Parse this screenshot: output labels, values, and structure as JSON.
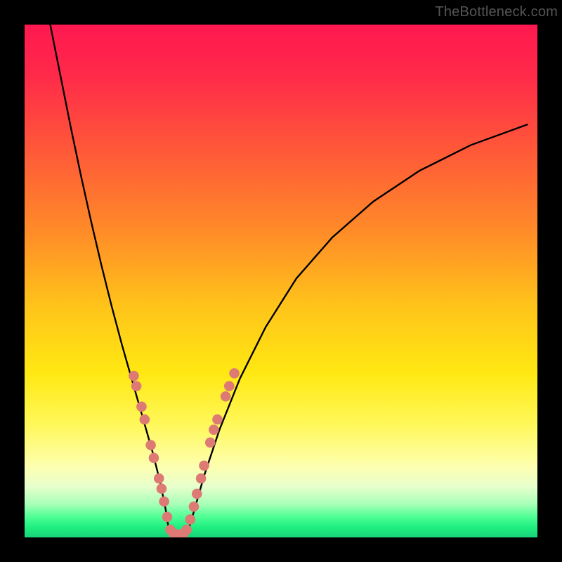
{
  "watermark": "TheBottleneck.com",
  "chart_data": {
    "type": "line",
    "title": "",
    "xlabel": "",
    "ylabel": "",
    "xlim": [
      0,
      100
    ],
    "ylim": [
      0,
      100
    ],
    "background_gradient_stops": [
      {
        "pos": 0.0,
        "color": "#ff1850"
      },
      {
        "pos": 0.1,
        "color": "#ff2a49"
      },
      {
        "pos": 0.25,
        "color": "#ff5a38"
      },
      {
        "pos": 0.4,
        "color": "#ff8a28"
      },
      {
        "pos": 0.55,
        "color": "#ffc41a"
      },
      {
        "pos": 0.68,
        "color": "#ffe812"
      },
      {
        "pos": 0.78,
        "color": "#fff85a"
      },
      {
        "pos": 0.86,
        "color": "#feffae"
      },
      {
        "pos": 0.9,
        "color": "#e8ffcc"
      },
      {
        "pos": 0.935,
        "color": "#a8ffb8"
      },
      {
        "pos": 0.96,
        "color": "#4fff95"
      },
      {
        "pos": 0.98,
        "color": "#1fef80"
      },
      {
        "pos": 1.0,
        "color": "#18d479"
      }
    ],
    "series": [
      {
        "name": "left-curve",
        "x": [
          5.0,
          7.0,
          9.0,
          11.0,
          13.0,
          15.0,
          17.0,
          19.0,
          21.0,
          23.0,
          25.0,
          26.5,
          27.5,
          28.2
        ],
        "y": [
          100.0,
          90.0,
          80.0,
          70.5,
          61.5,
          53.0,
          45.0,
          37.5,
          30.5,
          23.5,
          16.5,
          10.5,
          5.5,
          1.0
        ]
      },
      {
        "name": "valley-floor",
        "x": [
          28.2,
          29.0,
          30.0,
          31.0,
          31.8
        ],
        "y": [
          1.0,
          0.6,
          0.5,
          0.6,
          1.0
        ]
      },
      {
        "name": "right-curve",
        "x": [
          31.8,
          33.0,
          35.0,
          38.0,
          42.0,
          47.0,
          53.0,
          60.0,
          68.0,
          77.0,
          87.0,
          98.0
        ],
        "y": [
          1.0,
          5.0,
          12.0,
          21.0,
          31.0,
          41.0,
          50.5,
          58.5,
          65.5,
          71.5,
          76.5,
          80.5
        ]
      }
    ],
    "scatter_points": {
      "name": "data-markers",
      "color": "#dd7a74",
      "radius_est": 1.0,
      "points": [
        {
          "x": 21.3,
          "y": 31.5
        },
        {
          "x": 21.8,
          "y": 29.5
        },
        {
          "x": 22.8,
          "y": 25.5
        },
        {
          "x": 23.4,
          "y": 23.0
        },
        {
          "x": 24.6,
          "y": 18.0
        },
        {
          "x": 25.2,
          "y": 15.5
        },
        {
          "x": 26.2,
          "y": 11.5
        },
        {
          "x": 26.7,
          "y": 9.5
        },
        {
          "x": 27.2,
          "y": 7.0
        },
        {
          "x": 27.8,
          "y": 4.0
        },
        {
          "x": 28.4,
          "y": 1.5
        },
        {
          "x": 29.0,
          "y": 0.8
        },
        {
          "x": 30.0,
          "y": 0.6
        },
        {
          "x": 31.0,
          "y": 0.8
        },
        {
          "x": 31.6,
          "y": 1.5
        },
        {
          "x": 32.3,
          "y": 3.5
        },
        {
          "x": 33.0,
          "y": 6.0
        },
        {
          "x": 33.6,
          "y": 8.5
        },
        {
          "x": 34.4,
          "y": 11.5
        },
        {
          "x": 35.0,
          "y": 14.0
        },
        {
          "x": 36.2,
          "y": 18.5
        },
        {
          "x": 36.9,
          "y": 21.0
        },
        {
          "x": 37.6,
          "y": 23.0
        },
        {
          "x": 39.2,
          "y": 27.5
        },
        {
          "x": 39.9,
          "y": 29.5
        },
        {
          "x": 40.9,
          "y": 32.0
        }
      ]
    }
  }
}
